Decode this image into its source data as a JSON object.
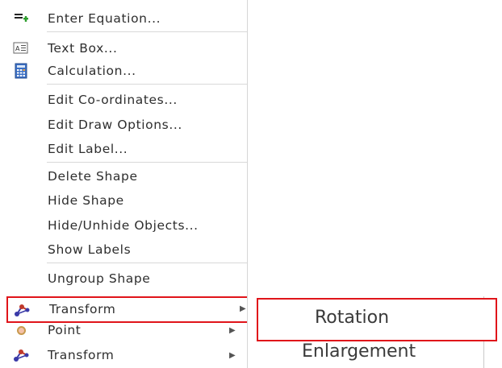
{
  "menu": {
    "items": [
      {
        "label": "Enter Equation...",
        "icon": "add-equation-icon"
      },
      {
        "label": "Text Box...",
        "icon": "text-box-icon"
      },
      {
        "label": "Calculation...",
        "icon": "calculator-icon"
      },
      {
        "label": "Edit Co-ordinates..."
      },
      {
        "label": "Edit Draw Options..."
      },
      {
        "label": "Edit Label..."
      },
      {
        "label": "Delete Shape"
      },
      {
        "label": "Hide Shape"
      },
      {
        "label": "Hide/Unhide Objects..."
      },
      {
        "label": "Show Labels"
      },
      {
        "label": "Ungroup Shape"
      },
      {
        "label": "Transform",
        "icon": "transform-icon",
        "submenu_arrow": "▶"
      },
      {
        "label": "Point",
        "icon": "point-icon",
        "submenu_arrow": "▶"
      },
      {
        "label": "Transform",
        "icon": "transform-icon",
        "submenu_arrow": "▶"
      }
    ]
  },
  "submenu": {
    "items": [
      {
        "label": "Rotation"
      },
      {
        "label": "Enlargement"
      }
    ]
  },
  "colors": {
    "highlight_border": "#e0141a",
    "calculator_blue": "#3b6fc4",
    "plus_green": "#2e9e2e"
  }
}
